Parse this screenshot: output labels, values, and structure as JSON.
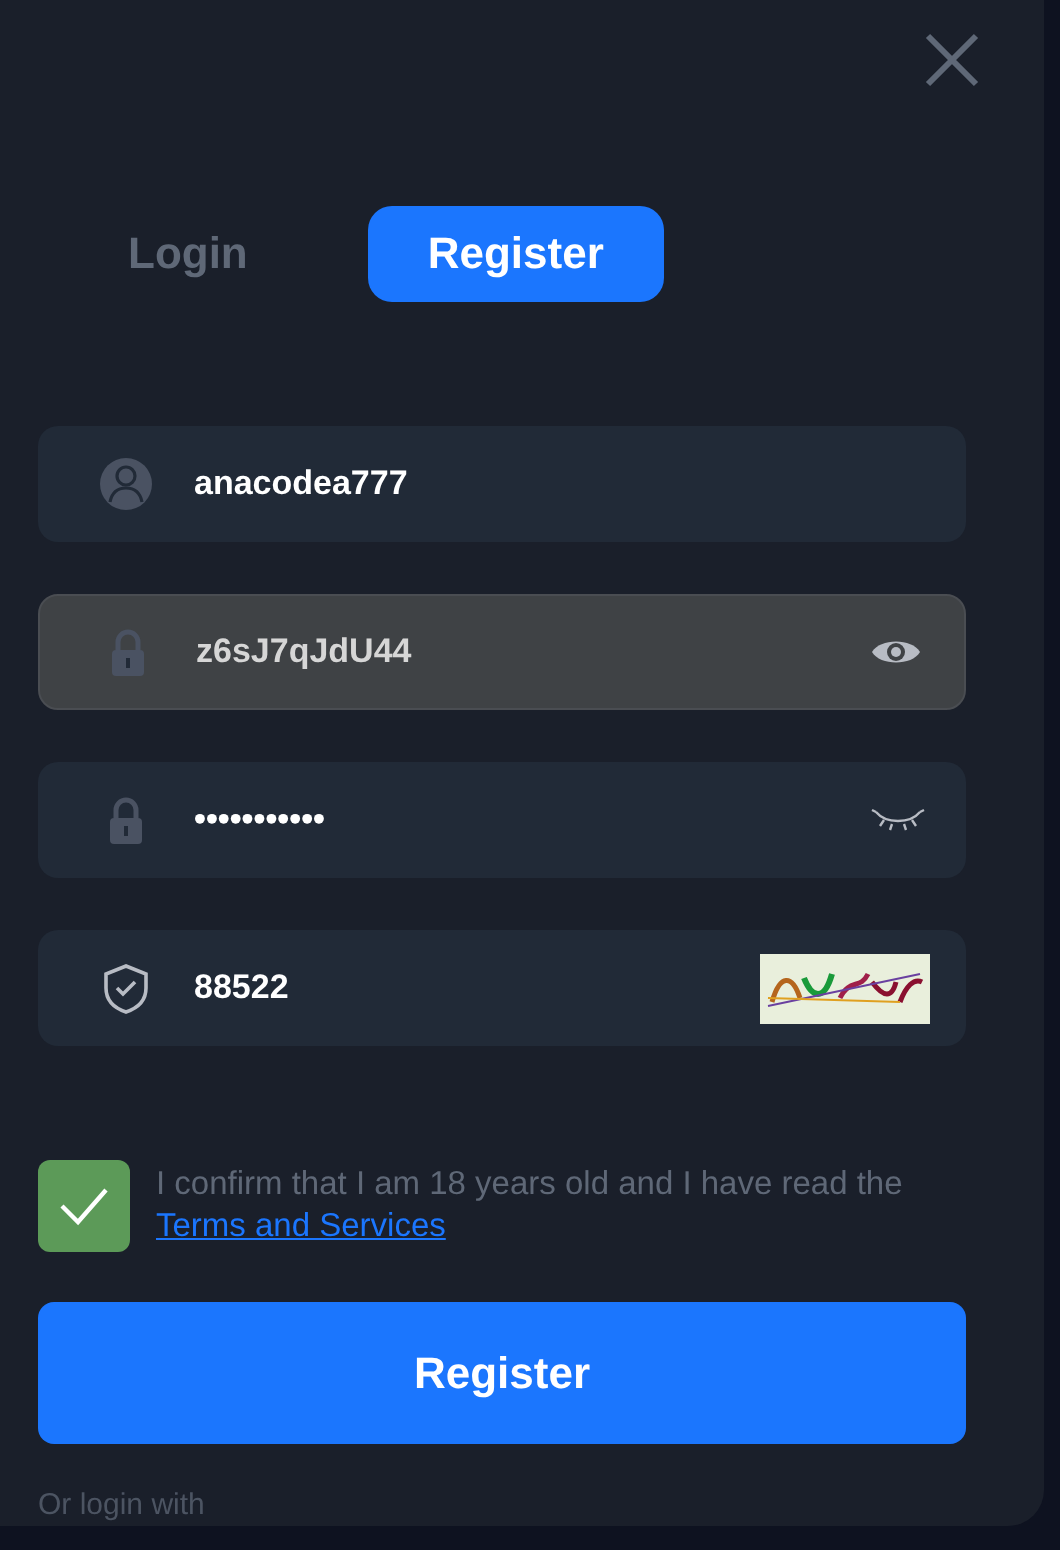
{
  "tabs": [
    {
      "label": "Login",
      "selected": false
    },
    {
      "label": "Register",
      "selected": true
    }
  ],
  "fields": [
    {
      "kind": "user",
      "value": "anacodea777",
      "focused": false
    },
    {
      "kind": "password",
      "value": "z6sJ7qJdU44",
      "focused": true,
      "visible": true
    },
    {
      "kind": "password",
      "value": "•••••••••••",
      "focused": false,
      "visible": false
    },
    {
      "kind": "captcha",
      "value": "88522",
      "focused": false
    }
  ],
  "agree": {
    "checked": true,
    "text": "I confirm that I am 18 years old and I have read the",
    "link": "Terms and Services"
  },
  "submit": "Register",
  "footer": "Or login with"
}
